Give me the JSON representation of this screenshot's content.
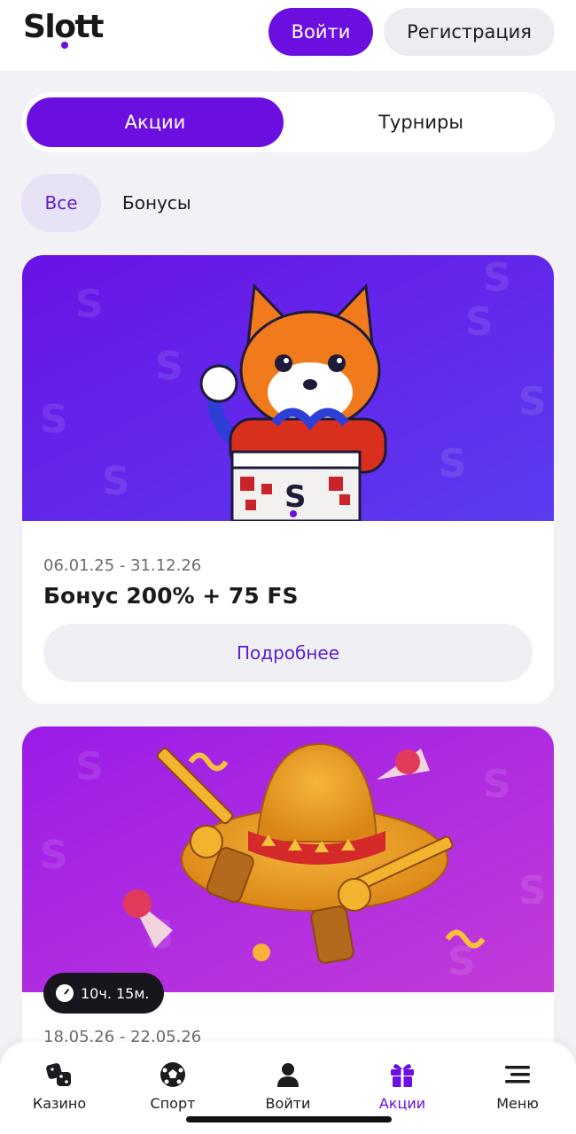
{
  "header": {
    "logo": "Slott",
    "login_label": "Войти",
    "register_label": "Регистрация"
  },
  "tabs": [
    {
      "label": "Акции",
      "active": true
    },
    {
      "label": "Турниры",
      "active": false
    }
  ],
  "filters": [
    {
      "label": "Все",
      "active": true
    },
    {
      "label": "Бонусы",
      "active": false
    }
  ],
  "promos": [
    {
      "dates": "06.01.25 - 31.12.26",
      "title": "Бонус 200% + 75 FS",
      "button": "Подробнее",
      "banner_icon": "fox-gift-banner"
    },
    {
      "dates": "18.05.26 - 22.05.26",
      "timer": "10ч. 15м.",
      "banner_icon": "sombrero-revolvers-banner"
    }
  ],
  "bottom_nav": [
    {
      "label": "Казино",
      "icon": "dice-icon",
      "active": false
    },
    {
      "label": "Спорт",
      "icon": "soccer-ball-icon",
      "active": false
    },
    {
      "label": "Войти",
      "icon": "user-icon",
      "active": false
    },
    {
      "label": "Акции",
      "icon": "gift-icon",
      "active": true
    },
    {
      "label": "Меню",
      "icon": "menu-icon",
      "active": false
    }
  ],
  "colors": {
    "accent": "#6a0fe0",
    "background": "#f2f2f6"
  }
}
